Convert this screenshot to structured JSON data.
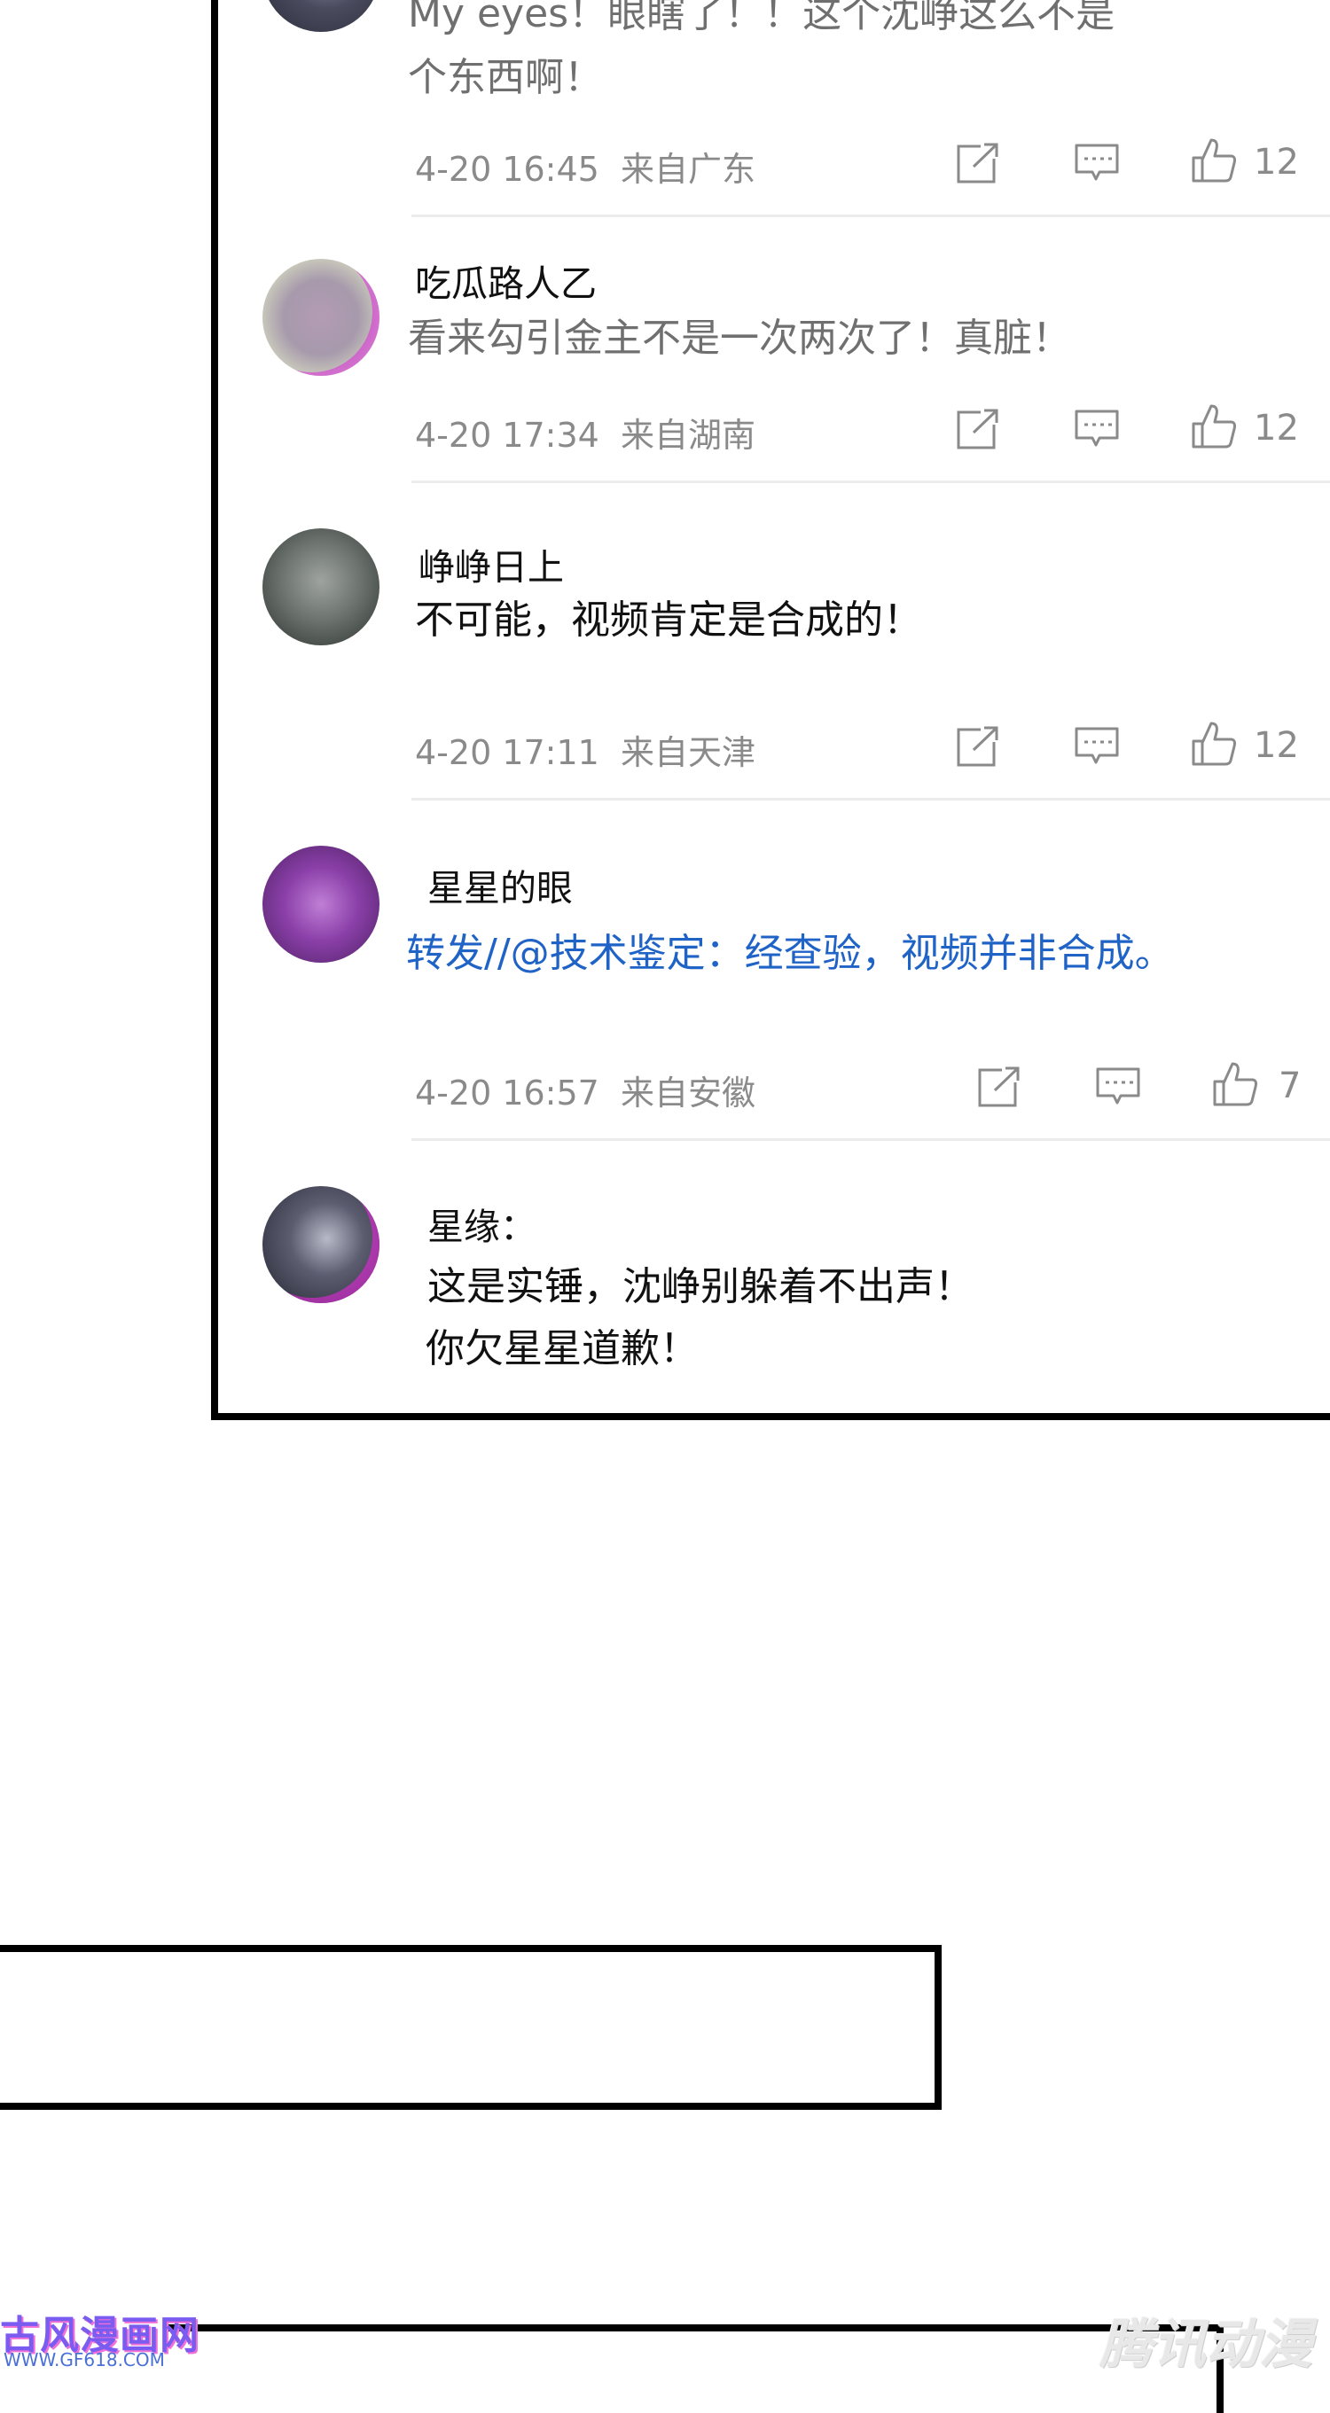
{
  "comments": [
    {
      "body_lines": [
        "My eyes！眼瞎了！！这个沈峥这么不是",
        "个东西啊！"
      ],
      "date": "4-20 16:45",
      "location": "来自广东",
      "likes": "12"
    },
    {
      "username": "吃瓜路人乙",
      "body_lines": [
        "看来勾引金主不是一次两次了！真脏！"
      ],
      "date": "4-20 17:34",
      "location": "来自湖南",
      "likes": "12"
    },
    {
      "username": "峥峥日上",
      "body_lines": [
        "不可能，视频肯定是合成的！"
      ],
      "date": "4-20 17:11",
      "location": "来自天津",
      "likes": "12"
    },
    {
      "username": "星星的眼",
      "body_lines": [
        "转发//@技术鉴定：经查验，视频并非合成。"
      ],
      "date": "4-20 16:57",
      "location": "来自安徽",
      "likes": "7"
    },
    {
      "username": "星缘：",
      "body_lines": [
        "这是实锤，沈峥别躲着不出声！",
        "你欠星星道歉！"
      ]
    }
  ],
  "colors": {
    "link_blue": "#1f63c7",
    "meta_gray": "#8a8a8a",
    "panel_border": "#000000"
  },
  "icons": [
    "share-icon",
    "comment-icon",
    "like-icon"
  ],
  "watermarks": {
    "left_title": "古风漫画网",
    "left_url": "WWW.GF618.COM",
    "right": "腾讯动漫"
  }
}
